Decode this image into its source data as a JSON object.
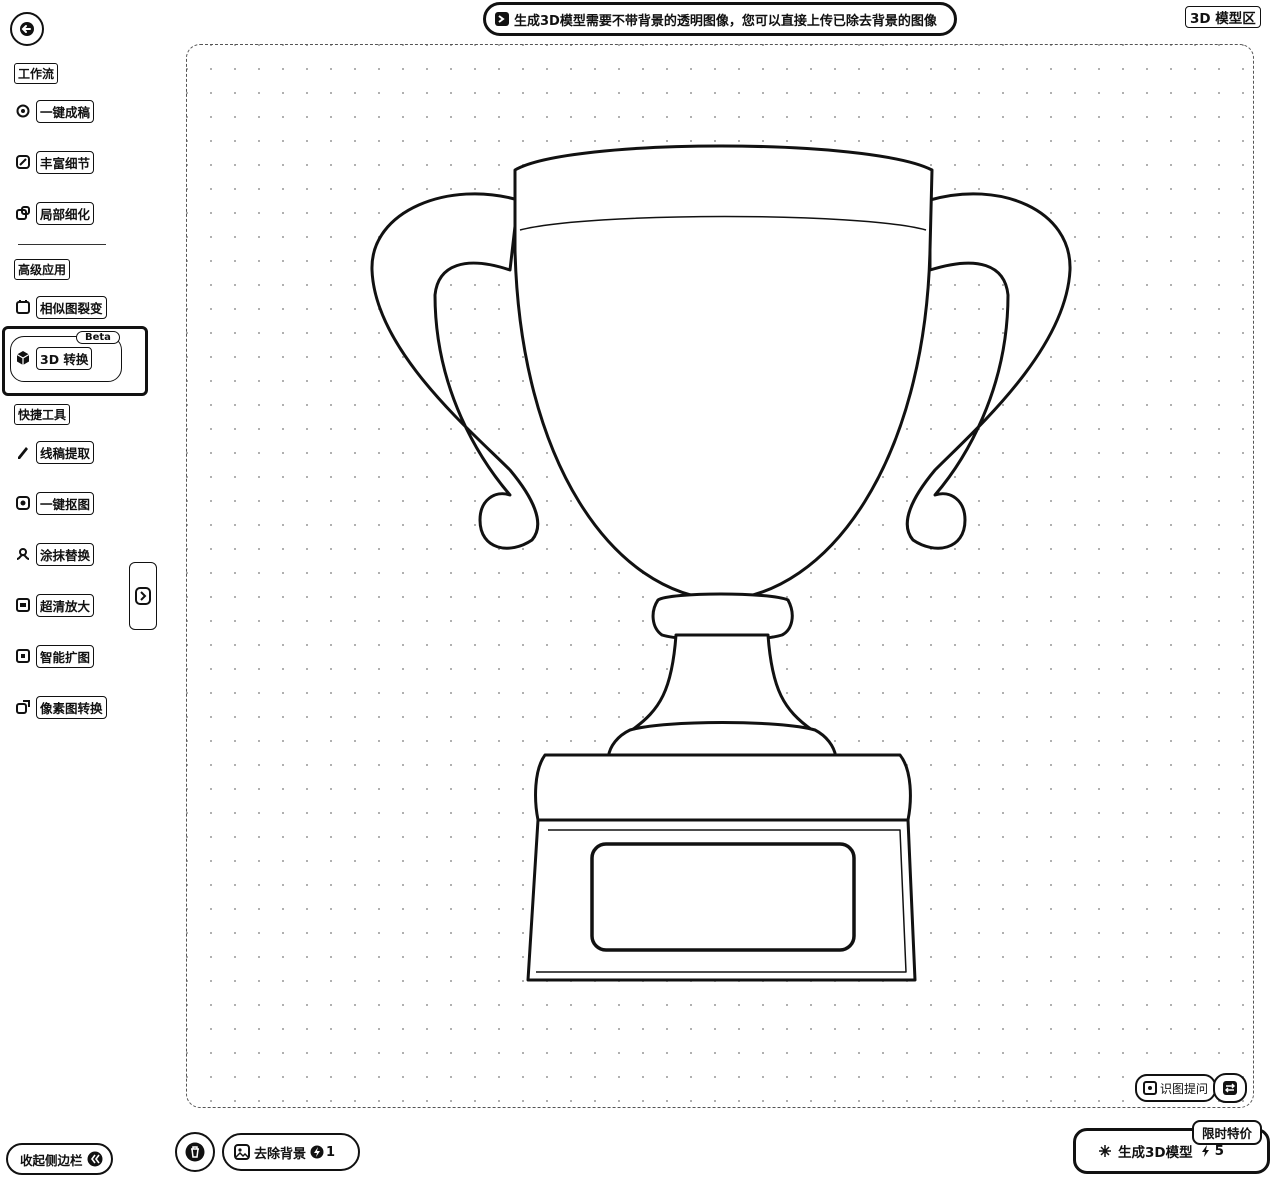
{
  "header": {
    "notice": "生成3D模型需要不带背景的透明图像，您可以直接上传已除去背景的图像",
    "zone_label": "3D 模型区"
  },
  "sidebar": {
    "sections": [
      {
        "title": "工作流"
      },
      {
        "title": "高级应用"
      },
      {
        "title": "快捷工具"
      }
    ],
    "workflow_items": [
      {
        "label": "一键成稿",
        "icon": "gear-icon"
      },
      {
        "label": "丰富细节",
        "icon": "leaf-icon"
      },
      {
        "label": "局部细化",
        "icon": "crop-icon"
      }
    ],
    "advanced_items": [
      {
        "label": "相似图裂变",
        "icon": "split-image-icon"
      },
      {
        "label": "3D 转换",
        "icon": "cube-icon",
        "badge": "Beta",
        "active": true
      }
    ],
    "tool_items": [
      {
        "label": "线稿提取",
        "icon": "pen-icon"
      },
      {
        "label": "一键抠图",
        "icon": "cutout-icon"
      },
      {
        "label": "涂抹替换",
        "icon": "brush-icon"
      },
      {
        "label": "超清放大",
        "icon": "upscale-icon"
      },
      {
        "label": "智能扩图",
        "icon": "expand-icon"
      },
      {
        "label": "像素图转换",
        "icon": "pixel-icon"
      }
    ]
  },
  "canvas": {
    "image_question_label": "识图提问"
  },
  "bottom": {
    "collapse_sidebar_label": "收起侧边栏",
    "remove_bg_label": "去除背景",
    "remove_bg_cost": "1",
    "generate_label": "生成3D模型",
    "generate_cost": "5",
    "promo_badge": "限时特价"
  }
}
